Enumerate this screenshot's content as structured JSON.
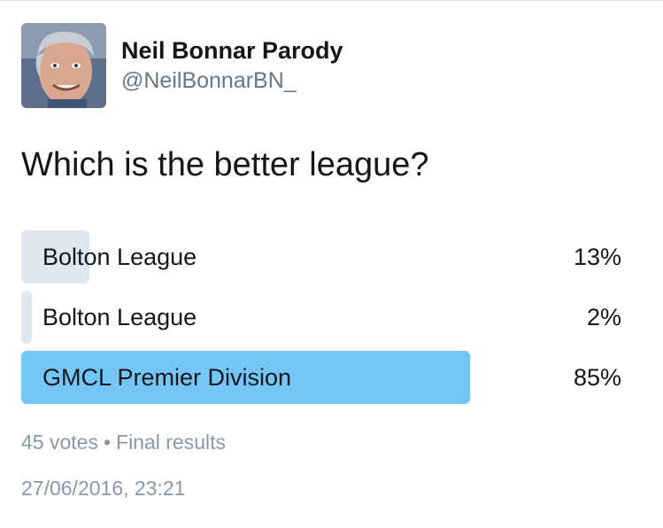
{
  "author": {
    "display_name": "Neil Bonnar Parody",
    "handle": "@NeilBonnarBN_"
  },
  "poll": {
    "question": "Which is the better league?",
    "options": [
      {
        "label": "Bolton League",
        "percent_label": "13%",
        "percent": 13
      },
      {
        "label": "Bolton League",
        "percent_label": "2%",
        "percent": 2
      },
      {
        "label": "GMCL Premier Division",
        "percent_label": "85%",
        "percent": 85
      }
    ],
    "votes": "45 votes",
    "separator": "•",
    "status": "Final results"
  },
  "timestamp": "27/06/2016, 23:21",
  "colors": {
    "bar_default": "#e1e8ed",
    "bar_winner": "#74c6f7",
    "text_primary": "#14171a",
    "text_secondary": "#657786"
  }
}
